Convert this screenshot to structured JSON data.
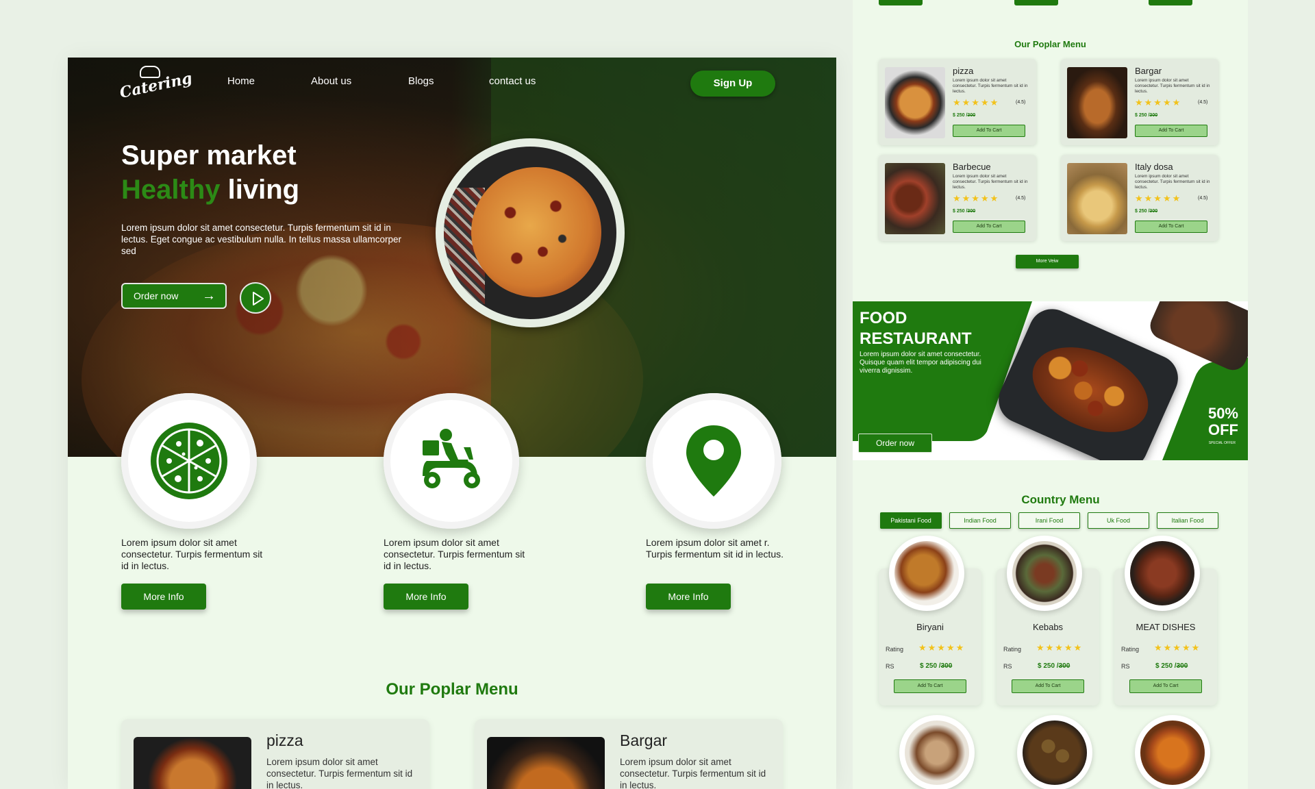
{
  "nav": {
    "logo": "Catering",
    "items": [
      "Home",
      "About us",
      "Blogs",
      "contact us"
    ],
    "signup": "Sign Up"
  },
  "hero": {
    "title_line1": "Super market",
    "title_green": "Healthy",
    "title_rest": "living",
    "description": "Lorem ipsum dolor sit amet consectetur. Turpis fermentum sit id in lectus. Eget congue ac vestibulum nulla. In tellus massa ullamcorper sed",
    "order_button": "Order  now"
  },
  "features": [
    {
      "icon": "pizza-icon",
      "text": "Lorem ipsum dolor sit amet consectetur. Turpis fermentum sit id in lectus.",
      "button": "More Info"
    },
    {
      "icon": "delivery-scooter-icon",
      "text": "Lorem ipsum dolor sit amet consectetur. Turpis fermentum sit id in lectus.",
      "button": "More Info"
    },
    {
      "icon": "location-pin-icon",
      "text": "Lorem ipsum dolor sit amet r. Turpis fermentum sit id in lectus.",
      "button": "More Info"
    }
  ],
  "popular": {
    "title": "Our Poplar Menu",
    "cards": [
      {
        "name": "pizza",
        "text": "Lorem ipsum dolor sit amet consectetur. Turpis fermentum sit id in lectus."
      },
      {
        "name": "Bargar",
        "text": "Lorem ipsum dolor sit amet consectetur. Turpis fermentum sit id in lectus."
      }
    ]
  },
  "right": {
    "popular_title": "Our Poplar Menu",
    "menu": [
      {
        "name": "pizza",
        "text": "Lorem ipsum dolor sit amet consectetur. Turpis fermentum sit id in lectus.",
        "rating": "(4.5)",
        "price": "$ 250 /",
        "old_price": "300",
        "cart": "Add To Cart"
      },
      {
        "name": "Bargar",
        "text": "Lorem ipsum dolor sit amet consectetur. Turpis fermentum sit id in lectus.",
        "rating": "(4.5)",
        "price": "$ 250 /",
        "old_price": "300",
        "cart": "Add To Cart"
      },
      {
        "name": "Barbecue",
        "text": "Lorem ipsum dolor sit amet consectetur. Turpis fermentum sit id in lectus.",
        "rating": "(4.5)",
        "price": "$ 250 /",
        "old_price": "300",
        "cart": "Add To Cart"
      },
      {
        "name": "Italy dosa",
        "text": "Lorem ipsum dolor sit amet consectetur. Turpis fermentum sit id in lectus.",
        "rating": "(4.5)",
        "price": "$ 250 /",
        "old_price": "300",
        "cart": "Add To Cart"
      }
    ],
    "more_view": "More Veiw",
    "banner": {
      "title_line1": "FOOD",
      "title_line2": "RESTAURANT",
      "description": "Lorem ipsum dolor sit amet consectetur. Quisque quam elit tempor adipiscing dui viverra dignissim.",
      "order": "Order now",
      "discount_line1": "50%",
      "discount_line2": "OFF",
      "special": "SPECIAL OFFER"
    },
    "country": {
      "title": "Country Menu",
      "tabs": [
        "Pakistani Food",
        "Indian Food",
        "Irani Food",
        "Uk Food",
        "Italian Food"
      ],
      "dishes": [
        {
          "name": "Biryani",
          "rating_label": "Rating",
          "rs": "RS",
          "price": "$ 250 /",
          "old_price": "300",
          "cart": "Add To Cart"
        },
        {
          "name": "Kebabs",
          "rating_label": "Rating",
          "rs": "RS",
          "price": "$ 250 /",
          "old_price": "300",
          "cart": "Add To Cart"
        },
        {
          "name": "MEAT DISHES",
          "rating_label": "Rating",
          "rs": "RS",
          "price": "$ 250 /",
          "old_price": "300",
          "cart": "Add To Cart"
        }
      ]
    }
  },
  "colors": {
    "brand_green": "#1f7a0f",
    "star": "#f2c21b",
    "page_bg": "#e9f1e6",
    "section_bg": "#eef9ea"
  }
}
